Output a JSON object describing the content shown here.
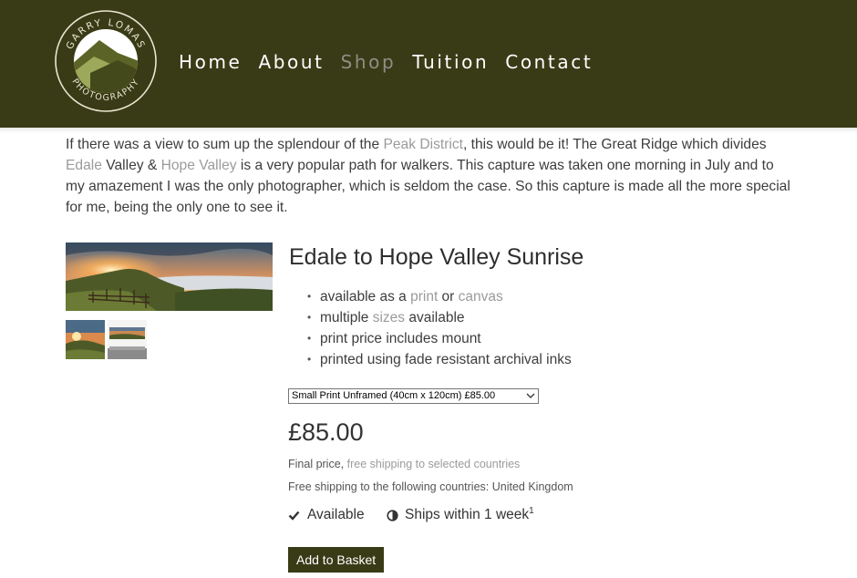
{
  "header": {
    "logo_text_top": "GARRY LOMAS",
    "logo_text_bottom": "PHOTOGRAPHY",
    "nav": [
      {
        "label": "Home"
      },
      {
        "label": "About"
      },
      {
        "label": "Shop"
      },
      {
        "label": "Tuition"
      },
      {
        "label": "Contact"
      }
    ],
    "active_nav": "Shop",
    "bg_color": "#393b17"
  },
  "intro": {
    "t1": "If there was a view to sum up the splendour of the ",
    "link_peak": "Peak District",
    "t2": ", this would be it! The Great Ridge which divides ",
    "link_edale": "Edale",
    "t3": " Valley & ",
    "link_hope": "Hope Valley",
    "t4": " is a very popular path for walkers. This capture was taken one morning in July and to my amazement I was the only photographer, which is seldom the case. So this capture is made all the more special for me, being the only one to see it."
  },
  "product": {
    "title": "Edale to Hope Valley Sunrise",
    "bullets": {
      "b1_pre": "available as a ",
      "b1_link1": "print",
      "b1_mid": " or ",
      "b1_link2": "canvas",
      "b2_pre": "multiple ",
      "b2_link": "sizes",
      "b2_post": " available",
      "b3": "print price includes mount",
      "b4": "printed using fade resistant archival inks"
    },
    "option_selected": "Small Print Unframed (40cm x 120cm) £85.00",
    "price": "£85.00",
    "final_price_label": "Final price, ",
    "final_price_link": "free shipping to selected countries",
    "free_shipping": "Free shipping to the following countries: United Kingdom",
    "availability": "Available",
    "ships": "Ships within 1 week",
    "ships_footnote": "1",
    "add_button": "Add to Basket",
    "icons": {
      "availability": "check-icon",
      "ships": "half-circle-icon"
    }
  }
}
